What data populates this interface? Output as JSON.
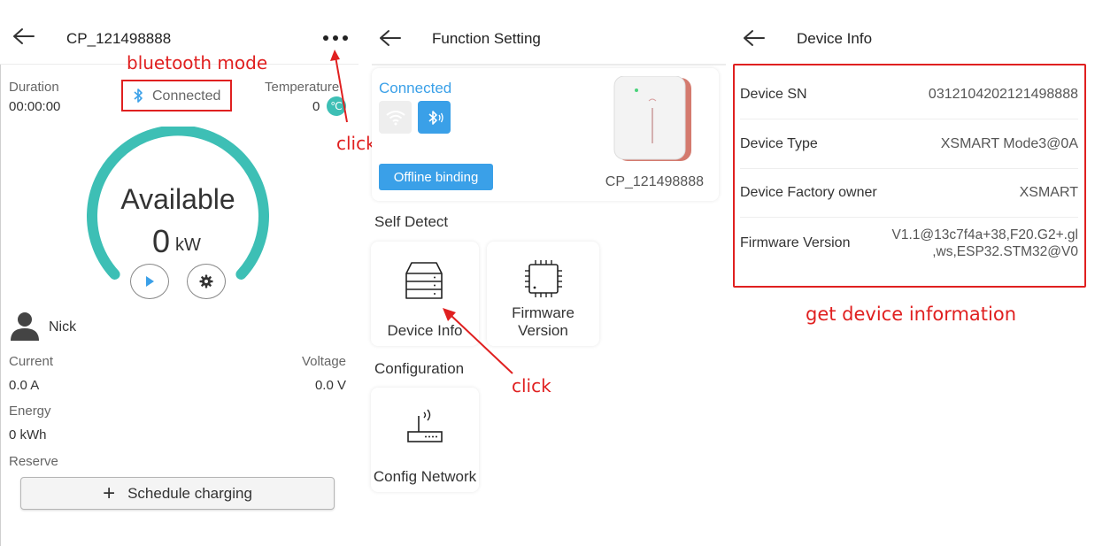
{
  "panel1": {
    "title": "CP_121498888",
    "menu_icon": "more-dots-icon",
    "duration_label": "Duration",
    "duration_value": "00:00:00",
    "bt_status": "Connected",
    "temperature_label": "Temperature",
    "temperature_value": "0",
    "temp_unit": "℃",
    "status": "Available",
    "power_value": "0",
    "power_unit": "kW",
    "user_name": "Nick",
    "current_label": "Current",
    "current_value": "0.0 A",
    "voltage_label": "Voltage",
    "voltage_value": "0.0 V",
    "energy_label": "Energy",
    "energy_value": "0 kWh",
    "reserve_label": "Reserve",
    "schedule_plus": "+",
    "schedule_label": "Schedule charging"
  },
  "panel2": {
    "title": "Function Setting",
    "connected": "Connected",
    "offline_binding": "Offline binding",
    "device_name": "CP_121498888",
    "self_detect": "Self Detect",
    "device_info": "Device Info",
    "firmware_line1": "Firmware",
    "firmware_line2": "Version",
    "configuration": "Configuration",
    "config_network": "Config Network"
  },
  "panel3": {
    "title": "Device Info",
    "rows": [
      {
        "key": "Device SN",
        "value": "0312104202121498888"
      },
      {
        "key": "Device Type",
        "value": "XSMART Mode3@0A"
      },
      {
        "key": "Device Factory owner",
        "value": "XSMART"
      },
      {
        "key": "Firmware Version",
        "value_line1": "V1.1@13c7f4a+38,F20.G2+.gl",
        "value_line2": ",ws,ESP32.STM32@V0"
      }
    ]
  },
  "annotations": {
    "bluetooth_mode": "bluetooth mode",
    "click1": "click",
    "click2": "click",
    "get_info": "get device information"
  },
  "colors": {
    "accent_teal": "#3dbfb5",
    "accent_blue": "#3aa0e8",
    "annotation_red": "#e02020"
  }
}
